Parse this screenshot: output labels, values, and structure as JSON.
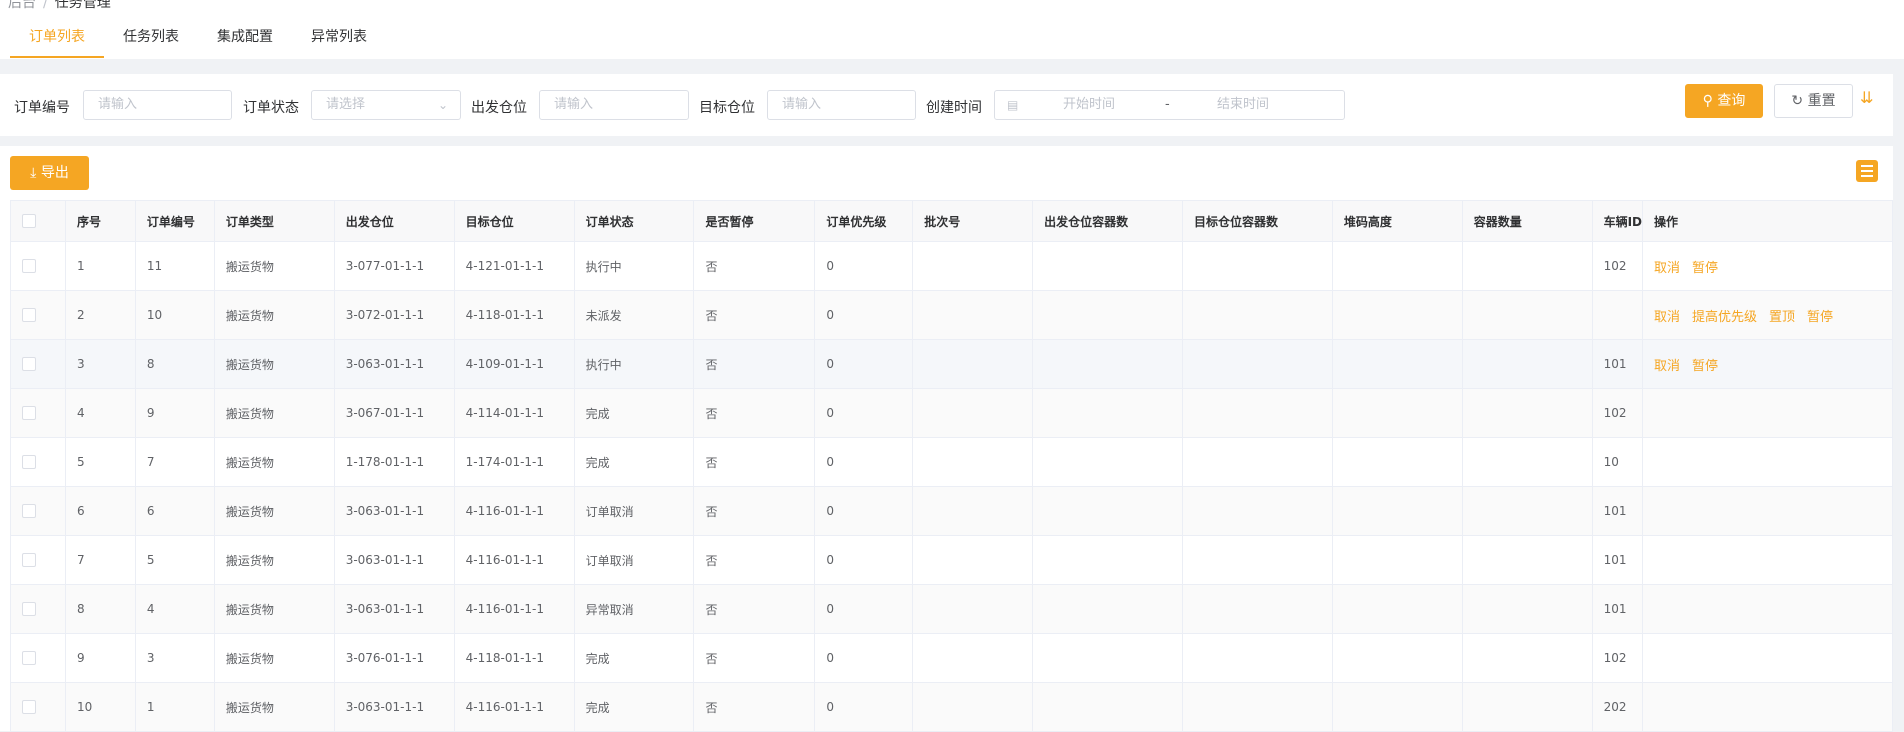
{
  "breadcrumb": {
    "parent": "后台",
    "sep": "/",
    "current": "任务管理"
  },
  "tabs": [
    {
      "label": "订单列表",
      "active": true
    },
    {
      "label": "任务列表"
    },
    {
      "label": "集成配置"
    },
    {
      "label": "异常列表"
    }
  ],
  "filters": {
    "order_no": {
      "label": "订单编号",
      "placeholder": "请输入"
    },
    "order_status": {
      "label": "订单状态",
      "placeholder": "请选择"
    },
    "from_loc": {
      "label": "出发仓位",
      "placeholder": "请输入"
    },
    "to_loc": {
      "label": "目标仓位",
      "placeholder": "请输入"
    },
    "created": {
      "label": "创建时间",
      "start_placeholder": "开始时间",
      "sep": "-",
      "end_placeholder": "结束时间"
    },
    "query_label": "查询",
    "reset_label": "重置"
  },
  "toolbar": {
    "export_label": "导出"
  },
  "table": {
    "columns": [
      "序号",
      "订单编号",
      "订单类型",
      "出发仓位",
      "目标仓位",
      "订单状态",
      "是否暂停",
      "订单优先级",
      "批次号",
      "出发仓位容器数",
      "目标仓位容器数",
      "堆码高度",
      "容器数量",
      "车辆ID",
      "操作"
    ],
    "rows": [
      {
        "idx": "1",
        "no": "11",
        "type": "搬运货物",
        "from": "3-077-01-1-1",
        "to": "4-121-01-1-1",
        "status": "执行中",
        "paused": "否",
        "priority": "0",
        "batch": "",
        "from_cnt": "",
        "to_cnt": "",
        "stack": "",
        "qty": "",
        "vehicle": "102",
        "actions": [
          "取消",
          "暂停"
        ]
      },
      {
        "idx": "2",
        "no": "10",
        "type": "搬运货物",
        "from": "3-072-01-1-1",
        "to": "4-118-01-1-1",
        "status": "未派发",
        "paused": "否",
        "priority": "0",
        "batch": "",
        "from_cnt": "",
        "to_cnt": "",
        "stack": "",
        "qty": "",
        "vehicle": "",
        "actions": [
          "取消",
          "提高优先级",
          "置顶",
          "暂停"
        ]
      },
      {
        "idx": "3",
        "no": "8",
        "type": "搬运货物",
        "from": "3-063-01-1-1",
        "to": "4-109-01-1-1",
        "status": "执行中",
        "paused": "否",
        "priority": "0",
        "batch": "",
        "from_cnt": "",
        "to_cnt": "",
        "stack": "",
        "qty": "",
        "vehicle": "101",
        "actions": [
          "取消",
          "暂停"
        ]
      },
      {
        "idx": "4",
        "no": "9",
        "type": "搬运货物",
        "from": "3-067-01-1-1",
        "to": "4-114-01-1-1",
        "status": "完成",
        "paused": "否",
        "priority": "0",
        "batch": "",
        "from_cnt": "",
        "to_cnt": "",
        "stack": "",
        "qty": "",
        "vehicle": "102",
        "actions": []
      },
      {
        "idx": "5",
        "no": "7",
        "type": "搬运货物",
        "from": "1-178-01-1-1",
        "to": "1-174-01-1-1",
        "status": "完成",
        "paused": "否",
        "priority": "0",
        "batch": "",
        "from_cnt": "",
        "to_cnt": "",
        "stack": "",
        "qty": "",
        "vehicle": "10",
        "actions": []
      },
      {
        "idx": "6",
        "no": "6",
        "type": "搬运货物",
        "from": "3-063-01-1-1",
        "to": "4-116-01-1-1",
        "status": "订单取消",
        "paused": "否",
        "priority": "0",
        "batch": "",
        "from_cnt": "",
        "to_cnt": "",
        "stack": "",
        "qty": "",
        "vehicle": "101",
        "actions": []
      },
      {
        "idx": "7",
        "no": "5",
        "type": "搬运货物",
        "from": "3-063-01-1-1",
        "to": "4-116-01-1-1",
        "status": "订单取消",
        "paused": "否",
        "priority": "0",
        "batch": "",
        "from_cnt": "",
        "to_cnt": "",
        "stack": "",
        "qty": "",
        "vehicle": "101",
        "actions": []
      },
      {
        "idx": "8",
        "no": "4",
        "type": "搬运货物",
        "from": "3-063-01-1-1",
        "to": "4-116-01-1-1",
        "status": "异常取消",
        "paused": "否",
        "priority": "0",
        "batch": "",
        "from_cnt": "",
        "to_cnt": "",
        "stack": "",
        "qty": "",
        "vehicle": "101",
        "actions": []
      },
      {
        "idx": "9",
        "no": "3",
        "type": "搬运货物",
        "from": "3-076-01-1-1",
        "to": "4-118-01-1-1",
        "status": "完成",
        "paused": "否",
        "priority": "0",
        "batch": "",
        "from_cnt": "",
        "to_cnt": "",
        "stack": "",
        "qty": "",
        "vehicle": "102",
        "actions": []
      },
      {
        "idx": "10",
        "no": "1",
        "type": "搬运货物",
        "from": "3-063-01-1-1",
        "to": "4-116-01-1-1",
        "status": "完成",
        "paused": "否",
        "priority": "0",
        "batch": "",
        "from_cnt": "",
        "to_cnt": "",
        "stack": "",
        "qty": "",
        "vehicle": "202",
        "actions": []
      }
    ]
  },
  "colors": {
    "accent": "#f5a623",
    "border": "#dcdfe6",
    "bg": "#f0f2f5"
  },
  "icons": {
    "query": "search-icon",
    "reset": "refresh-icon",
    "export": "download-icon",
    "expand": "double-chevron-down-icon",
    "columns": "list-icon",
    "date": "calendar-icon"
  }
}
